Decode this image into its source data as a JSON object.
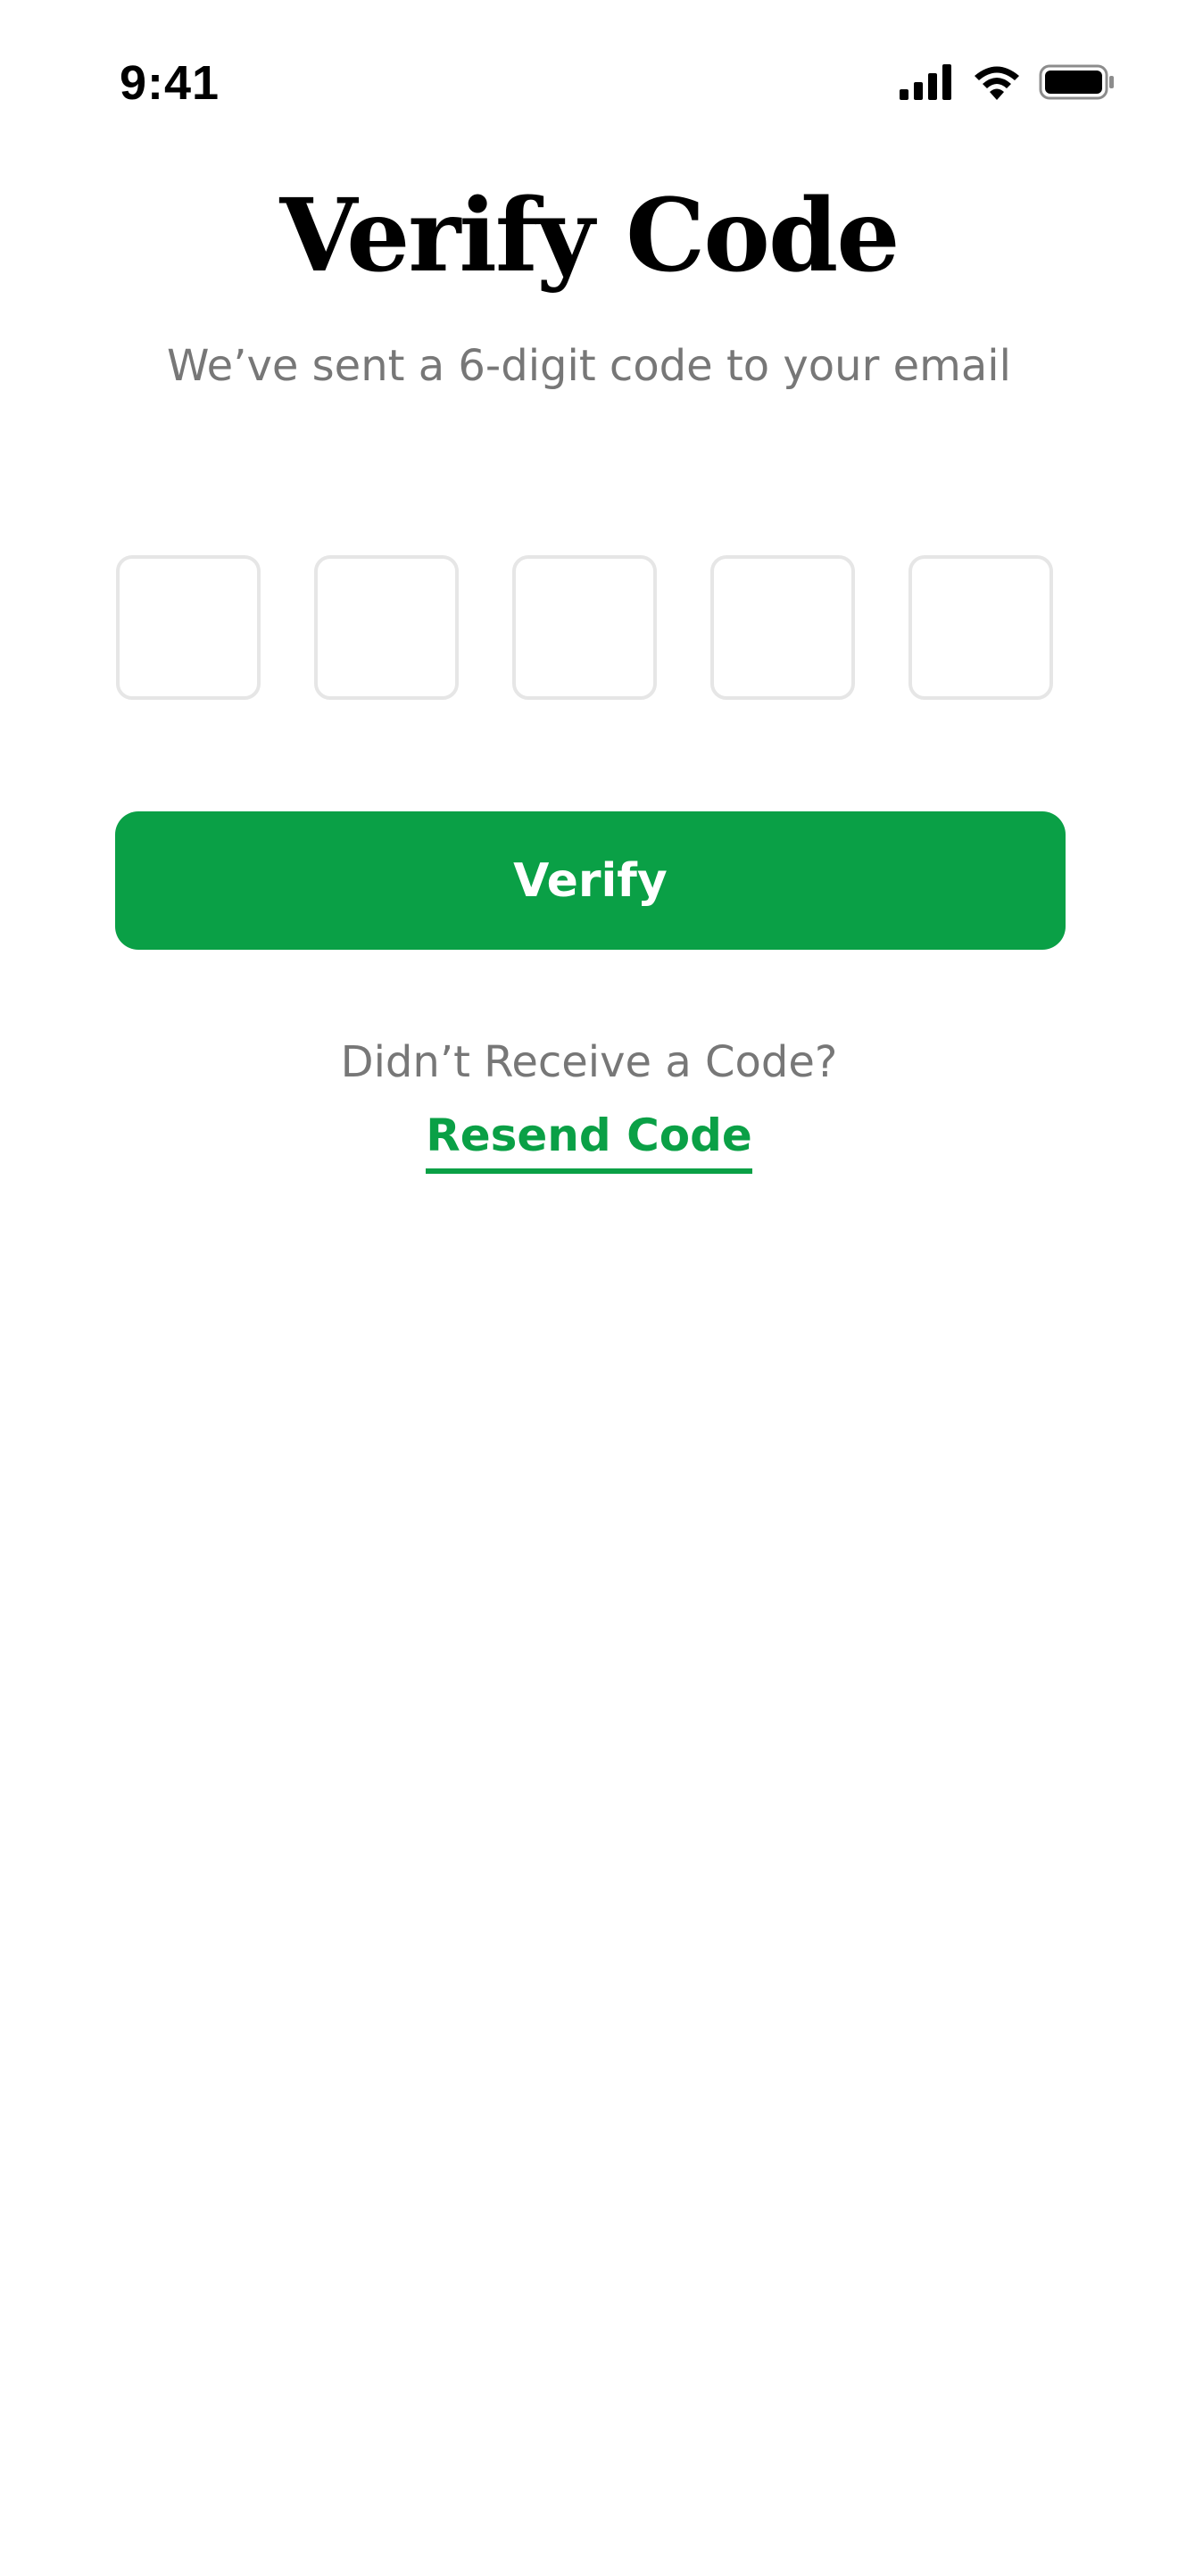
{
  "status_bar": {
    "time": "9:41",
    "icons": [
      "cellular-signal-icon",
      "wifi-icon",
      "battery-icon"
    ]
  },
  "header": {
    "title": "Verify Code",
    "subtitle": "We’ve sent a 6-digit code to your email"
  },
  "otp": {
    "digits": [
      "",
      "",
      "",
      "",
      ""
    ]
  },
  "verify_label": "Verify",
  "resend": {
    "prompt": "Didn’t Receive a Code?",
    "link_label": "Resend Code"
  },
  "colors": {
    "accent": "#0aa046",
    "muted_text": "#777777",
    "box_border": "#e6e6e6"
  }
}
